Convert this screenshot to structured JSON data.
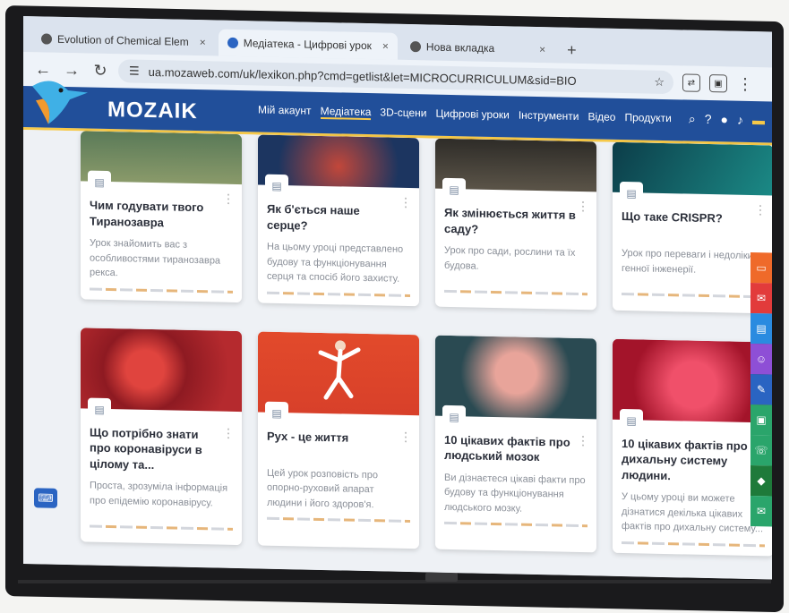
{
  "browser": {
    "tabs": [
      {
        "label": "Evolution of Chemical Elem",
        "close": "×"
      },
      {
        "label": "Медіатека - Цифрові урок",
        "close": "×"
      },
      {
        "label": "Нова вкладка",
        "close": "×"
      }
    ],
    "new_tab": "+",
    "url": "ua.mozaweb.com/uk/lexikon.php?cmd=getlist&let=MICROCURRICULUM&sid=BIO"
  },
  "site": {
    "logo": "MOZAIK",
    "menu": [
      "Мій акаунт",
      "Медіатека",
      "3D-сцени",
      "Цифрові уроки",
      "Інструменти",
      "Відео",
      "Продукти"
    ],
    "active_menu": "Медіатека"
  },
  "cards": [
    {
      "title": "Чим годувати твого Тиранозавра",
      "desc": "Урок знайомить вас з особливостями тиранозавра рекса.",
      "color": "#6f8a6a"
    },
    {
      "title": "Як б'ється наше серце?",
      "desc": "На цьому уроці представлено будову та функціонування серця та спосіб його захисту.",
      "color": "#233f6a"
    },
    {
      "title": "Як змінюється життя в саду?",
      "desc": "Урок про сади, рослини та їх будова.",
      "color": "#3d3b36"
    },
    {
      "title": "Що таке CRISPR?",
      "desc": "Урок про переваги і недоліки генної інженерії.",
      "color": "#0f5e63"
    },
    {
      "title": "Що потрібно знати про коронавіруси в цілому та...",
      "desc": "Проста, зрозуміла інформація про епідемію коронавірусу.",
      "color": "#a11f26"
    },
    {
      "title": "Рух - це життя",
      "desc": "Цей урок розповість про опорно-руховий апарат людини і його здоров'я.",
      "color": "#e24a2b"
    },
    {
      "title": "10 цікавих фактів про людський мозок",
      "desc": "Ви дізнаєтеся цікаві факти про будову та функціонування людського мозку.",
      "color": "#2a4a52"
    },
    {
      "title": "10 цікавих фактів про дихальну систему людини.",
      "desc": "У цьому уроці ви можете дізнатися декілька цікавих фактів про дихальну систему...",
      "color": "#b5172a"
    }
  ],
  "side_colors": [
    "#ef6a2a",
    "#e23b3b",
    "#2a8be0",
    "#8e4fd6",
    "#2a64c2",
    "#2aa56b",
    "#2aa56b",
    "#1e7a3a",
    "#2aa56b"
  ]
}
